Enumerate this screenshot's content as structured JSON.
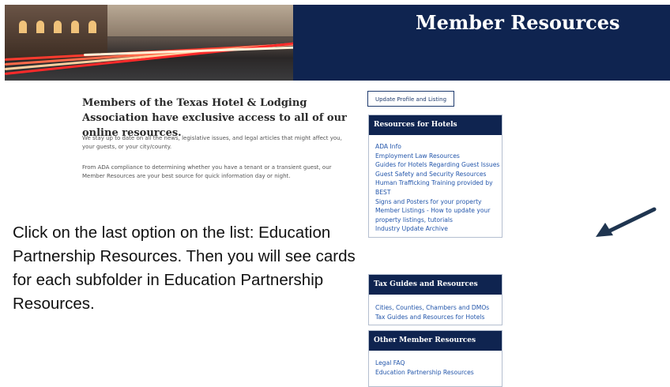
{
  "header": {
    "title": "Member Resources"
  },
  "intro": {
    "heading": "Members of the Texas Hotel & Lodging Association have exclusive access to all of our online resources.",
    "paragraph1": "We stay up to date on all the news, legislative issues, and legal articles that might affect you, your guests, or your city/county.",
    "paragraph2": "From ADA compliance to determining whether you have a tenant or a transient guest, our Member Resources are your best source for quick information day or night."
  },
  "instruction": "Click on the last option on the list: Education Partnership Resources. Then you will see cards for each subfolder in Education Partnership Resources.",
  "sidebar": {
    "update_button": "Update Profile and Listing",
    "sections": [
      {
        "title": "Resources for Hotels",
        "links": [
          "ADA Info",
          "Employment Law Resources",
          "Guides for Hotels Regarding Guest Issues",
          "Guest Safety and Security Resources",
          "Human Trafficking Training provided by BEST",
          "Signs and Posters for your property",
          "Member Listings - How to update your property listings, tutorials",
          "Industry Update Archive"
        ]
      },
      {
        "title": "Tax Guides and Resources",
        "links": [
          "Cities, Counties, Chambers and DMOs",
          "Tax Guides and Resources for Hotels"
        ]
      },
      {
        "title": "Other Member Resources",
        "links": [
          "Legal FAQ",
          "Education Partnership Resources"
        ]
      }
    ]
  },
  "icons": {
    "banner_image": "night-street-photo",
    "pointer": "arrow-icon"
  },
  "colors": {
    "navy": "#0f2450",
    "link": "#2255aa",
    "arrow": "#1f3550"
  }
}
